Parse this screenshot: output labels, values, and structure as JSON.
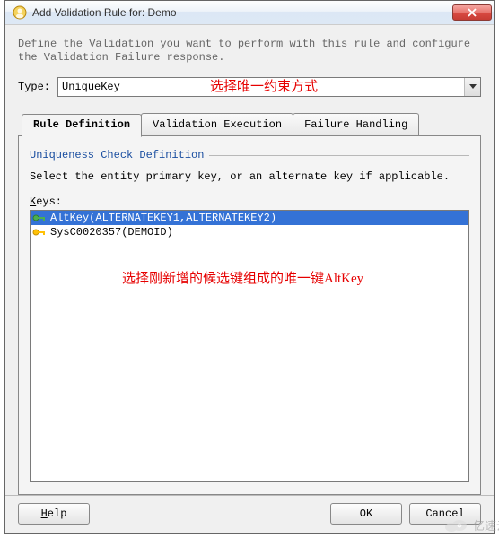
{
  "window": {
    "title": "Add Validation Rule for: Demo",
    "description": "Define the Validation you want to perform with this rule and configure the Validation Failure response."
  },
  "type": {
    "label_pre": "T",
    "label_post": "ype:",
    "value": "UniqueKey"
  },
  "annotations": {
    "type_hint": "选择唯一约束方式",
    "keys_hint": "选择刚新增的候选键组成的唯一键AltKey"
  },
  "tabs": [
    {
      "label": "Rule Definition",
      "active": true
    },
    {
      "label": "Validation Execution",
      "active": false
    },
    {
      "label": "Failure Handling",
      "active": false
    }
  ],
  "panel": {
    "fieldset_title": "Uniqueness Check Definition",
    "instruction": "Select the entity primary key, or an alternate key if applicable.",
    "keys_label_pre": "K",
    "keys_label_post": "eys:"
  },
  "keys": [
    {
      "label": "AltKey(ALTERNATEKEY1,ALTERNATEKEY2)",
      "icon": "key-green",
      "selected": true
    },
    {
      "label": "SysC0020357(DEMOID)",
      "icon": "key-yellow",
      "selected": false
    }
  ],
  "buttons": {
    "help": "Help",
    "ok": "OK",
    "cancel": "Cancel"
  },
  "watermark": "亿速云"
}
